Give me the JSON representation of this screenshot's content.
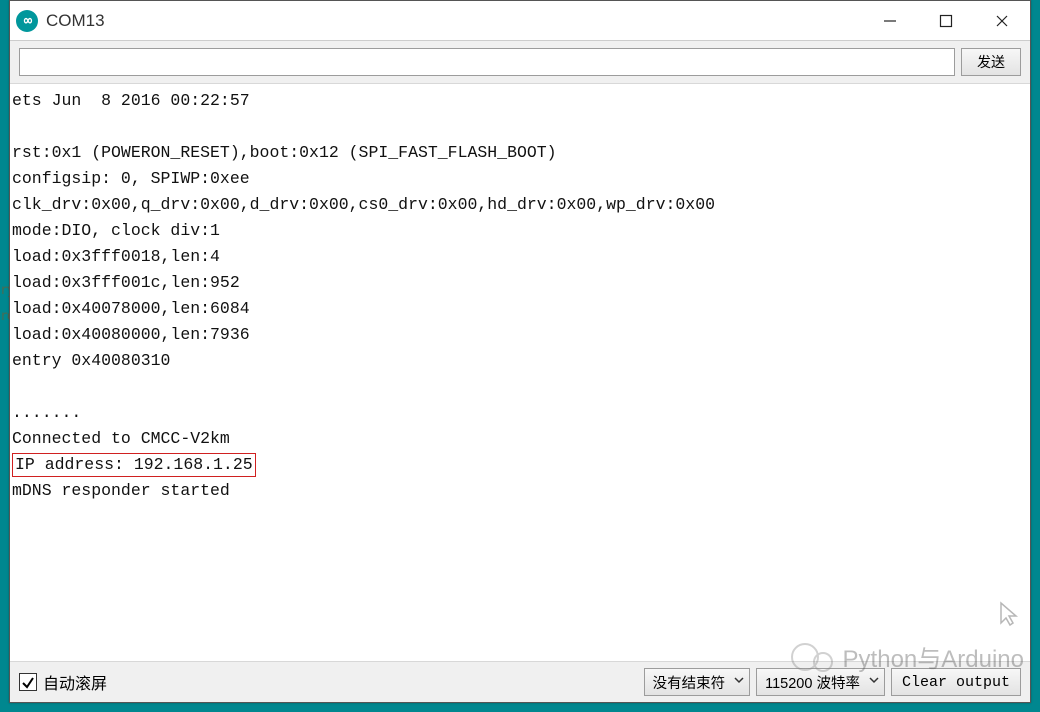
{
  "window": {
    "title": "COM13"
  },
  "toolbar": {
    "send_button": "发送",
    "input_value": ""
  },
  "output": {
    "lines": [
      "ets Jun  8 2016 00:22:57",
      "",
      "rst:0x1 (POWERON_RESET),boot:0x12 (SPI_FAST_FLASH_BOOT)",
      "configsip: 0, SPIWP:0xee",
      "clk_drv:0x00,q_drv:0x00,d_drv:0x00,cs0_drv:0x00,hd_drv:0x00,wp_drv:0x00",
      "mode:DIO, clock div:1",
      "load:0x3fff0018,len:4",
      "load:0x3fff001c,len:952",
      "load:0x40078000,len:6084",
      "load:0x40080000,len:7936",
      "entry 0x40080310",
      "",
      ".......",
      "Connected to CMCC-V2km"
    ],
    "highlight_line": "IP address: 192.168.1.25",
    "after_lines": [
      "mDNS responder started"
    ]
  },
  "footer": {
    "autoscroll_label": "自动滚屏",
    "autoscroll_checked": true,
    "line_ending_label": "没有结束符",
    "baud_label": "115200 波特率",
    "clear_label": "Clear output"
  },
  "watermark": "Python与Arduino",
  "left_hints": [
    "ry",
    "rd"
  ]
}
